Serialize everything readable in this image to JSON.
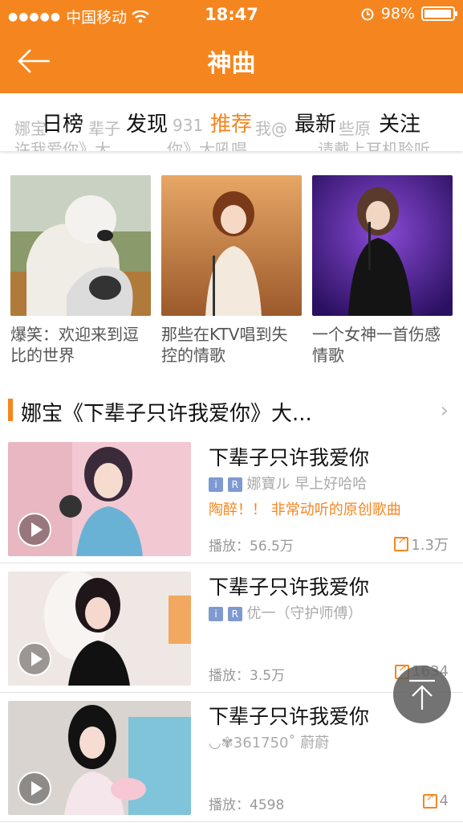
{
  "status_bar": {
    "carrier": "中国移动",
    "time": "18:47",
    "battery": "98%",
    "battery_level": 0.98
  },
  "nav": {
    "title": "神曲"
  },
  "tabs": [
    "日榜",
    "发现",
    "推荐",
    "最新",
    "关注"
  ],
  "active_tab": "推荐",
  "ghost_text": [
    "娜宝",
    "辈子",
    "931",
    "我@",
    "些原",
    "许我爱你》大...",
    "你》大吼唱",
    "请戴上耳机聆听"
  ],
  "cards": [
    {
      "caption": "爆笑：欢迎来到逗比的世界"
    },
    {
      "caption": "那些在KTV唱到失控的情歌"
    },
    {
      "caption": "一个女神一首伤感情歌"
    }
  ],
  "section": {
    "title": "娜宝《下辈子只许我爱你》大..."
  },
  "videos": [
    {
      "name": "下辈子只许我爱你",
      "tags": [
        "i",
        "R"
      ],
      "author": "娜寶ル 早上好哈哈",
      "desc": "陶醉！！ 非常动听的原创歌曲",
      "plays": "播放：56.5万",
      "shares": "1.3万"
    },
    {
      "name": "下辈子只许我爱你",
      "tags": [
        "i",
        "R"
      ],
      "author": "优一（守护师傅）",
      "desc": "",
      "plays": "播放：3.5万",
      "shares": "1634"
    },
    {
      "name": "下辈子只许我爱你",
      "tags": [],
      "author": "◡✾361750˚ 蔚蔚",
      "desc": "",
      "plays": "播放：4598",
      "shares": "4"
    }
  ],
  "colors": {
    "accent": "#f5861f",
    "tag_blue": "#7e9ad1"
  },
  "icons": [
    "back-arrow-icon",
    "wifi-icon",
    "alarm-icon",
    "battery-icon",
    "play-icon",
    "share-icon",
    "scroll-top-icon",
    "chevron-right-icon"
  ]
}
